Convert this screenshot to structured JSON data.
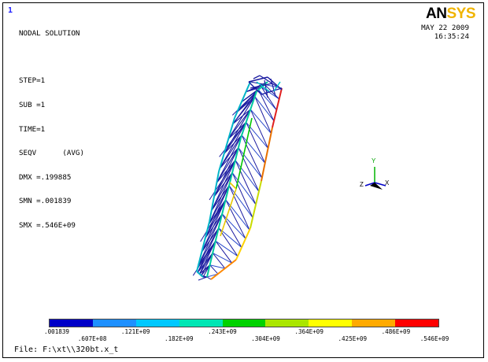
{
  "window_number": "1",
  "header": {
    "title": "NODAL SOLUTION",
    "step": "STEP=1",
    "sub": "SUB =1",
    "time": "TIME=1",
    "seqv": "SEQV      (AVG)",
    "dmx": "DMX =.199885",
    "smn": "SMN =.001839",
    "smx": "SMX =.546E+09"
  },
  "logo": {
    "an": "AN",
    "sys": "SYS"
  },
  "date": "MAY 22 2009",
  "time_of_day": "16:35:24",
  "triad": {
    "x": "X",
    "y": "Y",
    "z": "Z"
  },
  "legend": {
    "colors": [
      "#0000c8",
      "#1e90ff",
      "#00c8ff",
      "#00e6b4",
      "#00d200",
      "#aae600",
      "#ffff00",
      "#ffaa00",
      "#ff0000"
    ],
    "lower_labels": [
      ".001839",
      ".121E+09",
      ".243E+09",
      ".364E+09",
      ".486E+09"
    ],
    "upper_labels": [
      ".607E+08",
      ".182E+09",
      ".304E+09",
      ".425E+09",
      ".546E+09"
    ]
  },
  "file": "File: F:\\xt\\\\320bt.x_t"
}
